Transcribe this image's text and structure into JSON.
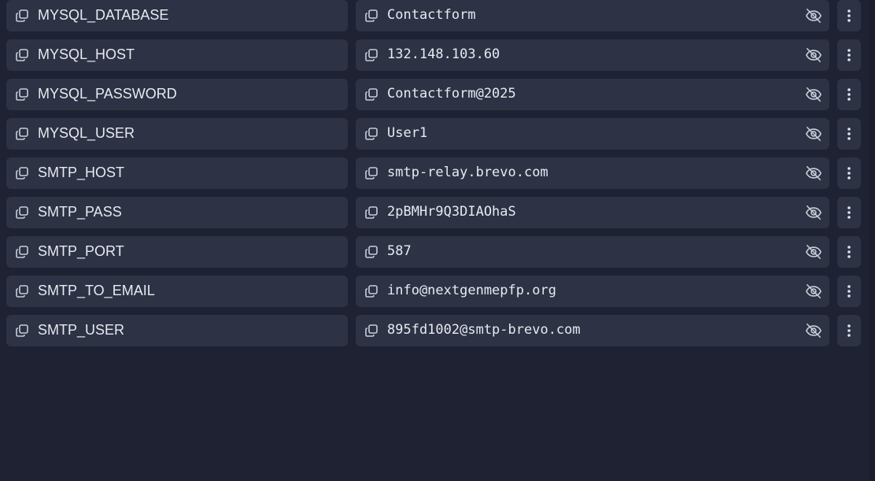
{
  "variables": [
    {
      "key": "MYSQL_DATABASE",
      "value": "Contactform"
    },
    {
      "key": "MYSQL_HOST",
      "value": "132.148.103.60"
    },
    {
      "key": "MYSQL_PASSWORD",
      "value": "Contactform@2025"
    },
    {
      "key": "MYSQL_USER",
      "value": "User1"
    },
    {
      "key": "SMTP_HOST",
      "value": "smtp-relay.brevo.com"
    },
    {
      "key": "SMTP_PASS",
      "value": "2pBMHr9Q3DIAOhaS"
    },
    {
      "key": "SMTP_PORT",
      "value": "587"
    },
    {
      "key": "SMTP_TO_EMAIL",
      "value": "info@nextgenmepfp.org"
    },
    {
      "key": "SMTP_USER",
      "value": "895fd1002@smtp-brevo.com"
    }
  ],
  "icons": {
    "copy": "copy-icon",
    "visibility": "eye-off-icon",
    "menu": "more-vertical-icon"
  },
  "colors": {
    "background": "#1e2232",
    "field": "#2d3245",
    "text": "#e8eaf0",
    "icon": "#c9cdd8"
  }
}
